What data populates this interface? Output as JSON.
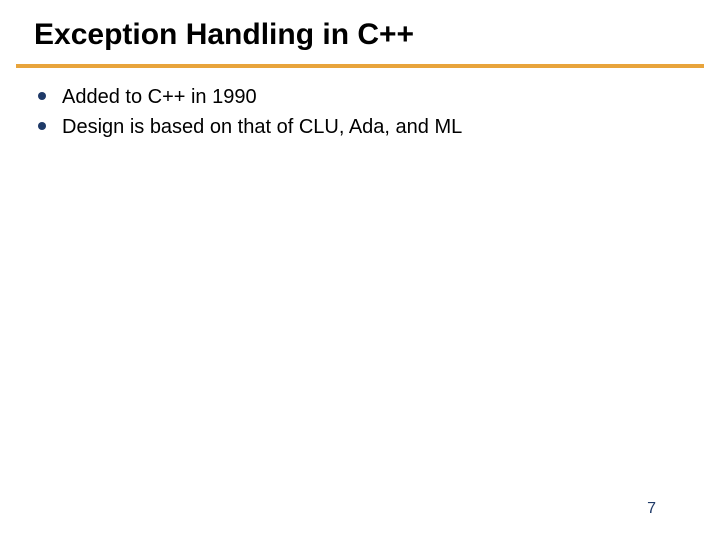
{
  "title": "Exception Handling in C++",
  "bullets": [
    "Added to C++ in 1990",
    "Design is based on that of CLU, Ada, and ML"
  ],
  "page_number": "7",
  "colors": {
    "underline": "#e8a43c",
    "bullet": "#1f3a68",
    "pagenum": "#1f3a68"
  }
}
